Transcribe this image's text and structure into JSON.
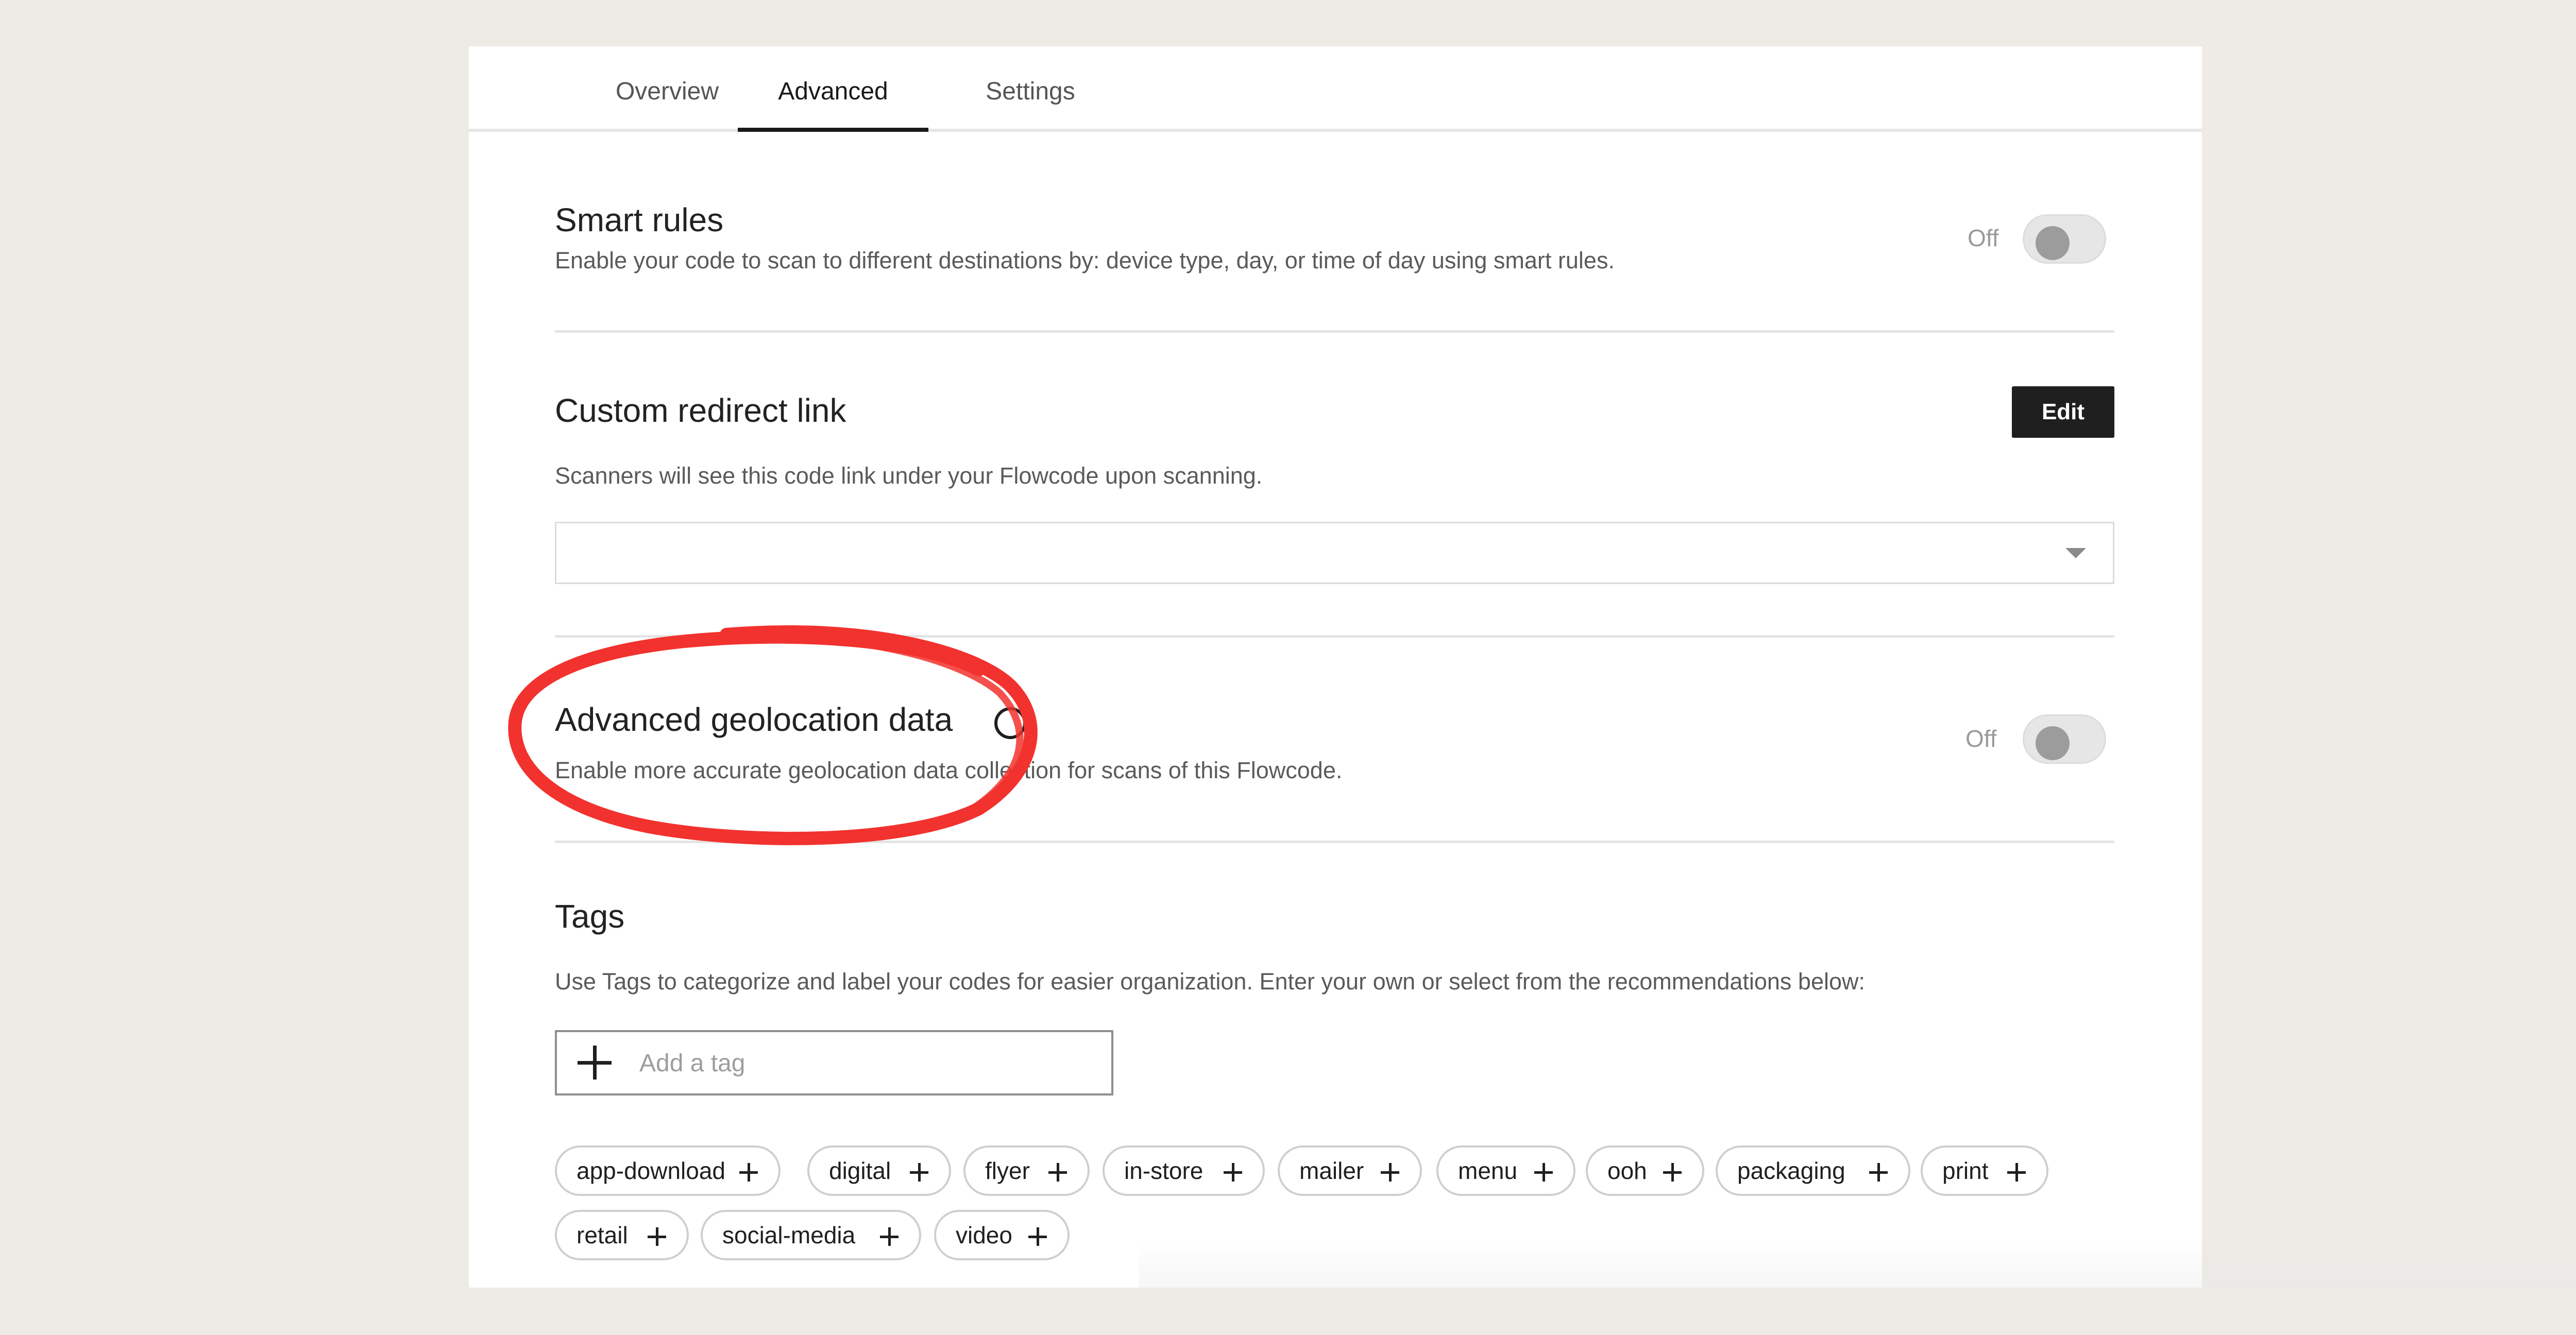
{
  "tabs": [
    {
      "label": "Overview",
      "active": false
    },
    {
      "label": "Advanced",
      "active": true
    },
    {
      "label": "Settings",
      "active": false
    }
  ],
  "smart_rules": {
    "title": "Smart rules",
    "description": "Enable your code to scan to different destinations by: device type, day, or time of day using smart rules.",
    "toggle_label": "Off",
    "enabled": false
  },
  "custom_redirect": {
    "title": "Custom redirect link",
    "edit_label": "Edit",
    "description": "Scanners will see this code link under your Flowcode upon scanning.",
    "selected_value": ""
  },
  "geolocation": {
    "title": "Advanced geolocation data",
    "description": "Enable more accurate geolocation data collection for scans of this Flowcode.",
    "toggle_label": "Off",
    "enabled": false
  },
  "tags": {
    "title": "Tags",
    "description": "Use Tags to categorize and label your codes for easier organization. Enter your own or select from the recommendations below:",
    "input_placeholder": "Add a tag",
    "recommendations": [
      "app-download",
      "digital",
      "flyer",
      "in-store",
      "mailer",
      "menu",
      "ooh",
      "packaging",
      "print",
      "retail",
      "social-media",
      "video"
    ]
  },
  "colors": {
    "background": "#eeebe6",
    "panel": "#ffffff",
    "accent_dark": "#1f1f1f",
    "annotation_red": "#f2322e"
  }
}
